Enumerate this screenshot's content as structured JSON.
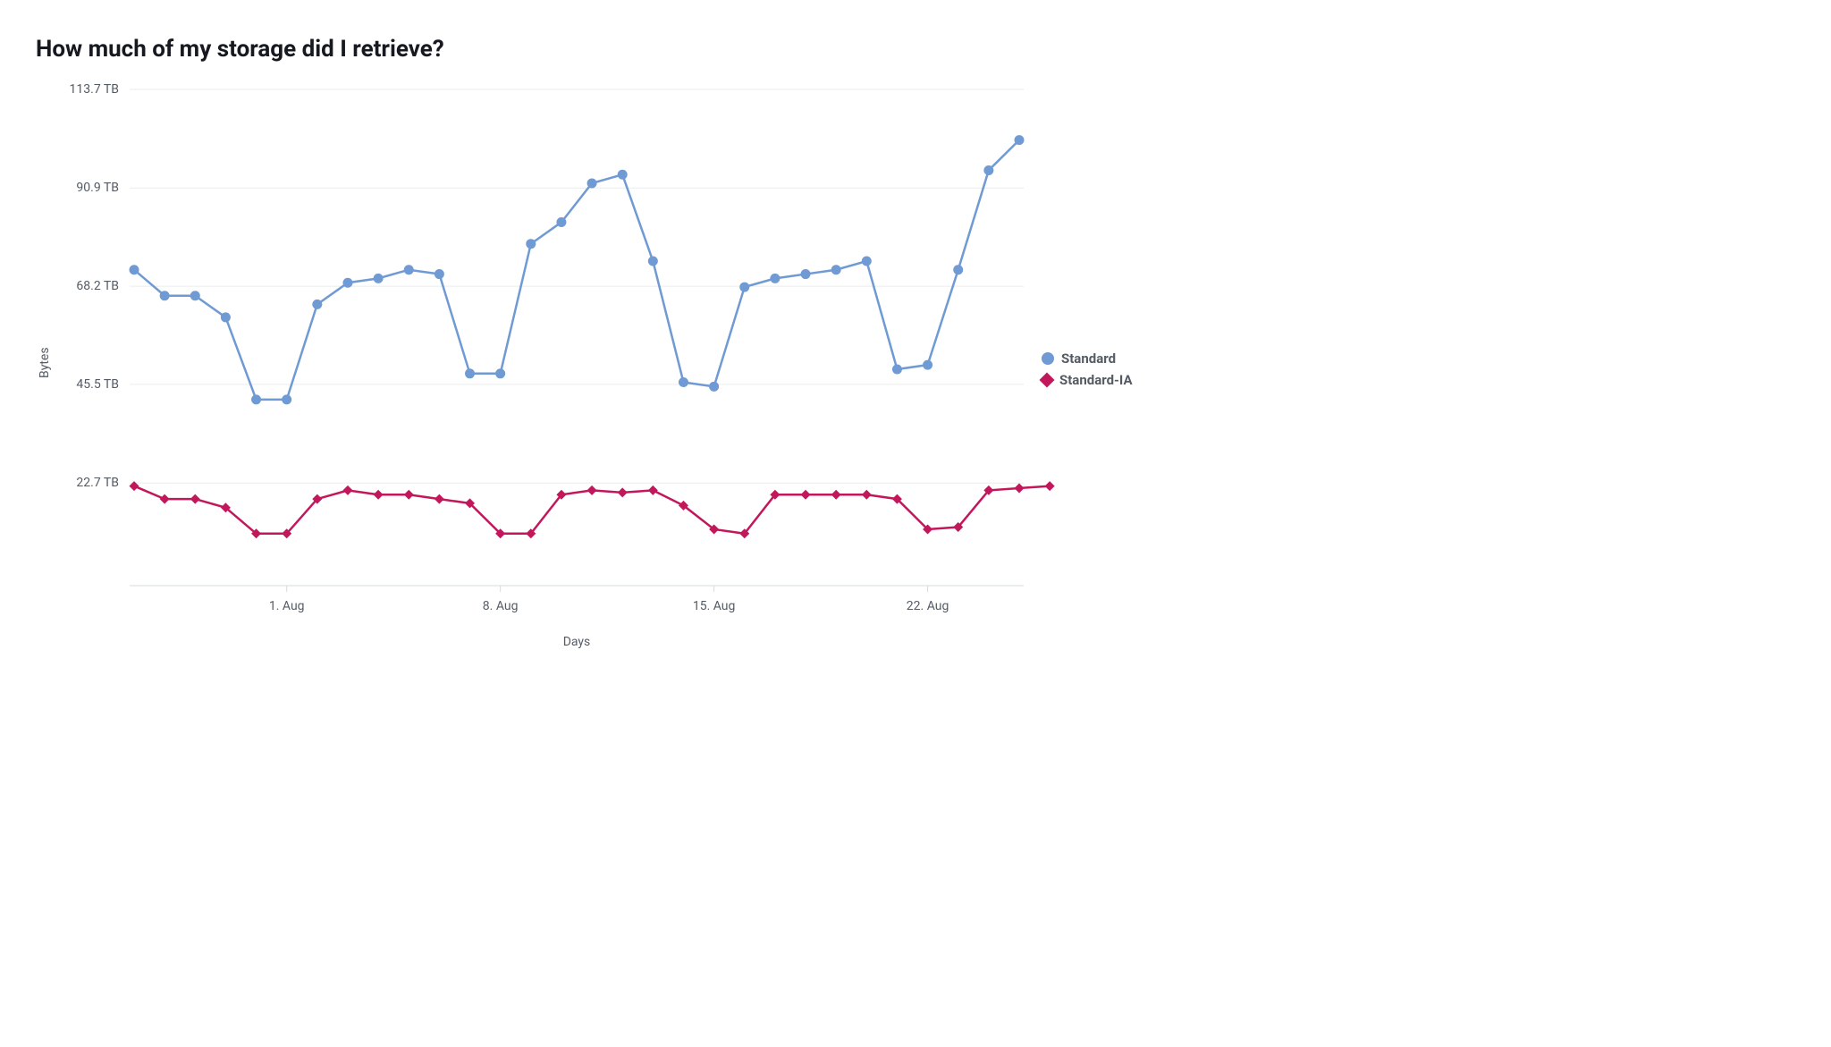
{
  "title": "How much of my storage did I retrieve?",
  "ylabel": "Bytes",
  "xlabel": "Days",
  "y_ticks": [
    "113.7 TB",
    "90.9 TB",
    "68.2 TB",
    "45.5 TB",
    "22.7 TB"
  ],
  "x_ticks": [
    "1. Aug",
    "8. Aug",
    "15. Aug",
    "22. Aug"
  ],
  "legend": {
    "standard": "Standard",
    "standard_ia": "Standard-IA"
  },
  "chart_data": {
    "type": "line",
    "xlabel": "Days",
    "ylabel": "Bytes",
    "title": "How much of my storage did I retrieve?",
    "ylim": [
      0,
      113.7
    ],
    "y_unit": "TB",
    "x": [
      "Jul 27",
      "Jul 28",
      "Jul 29",
      "Jul 30",
      "Jul 31",
      "Aug 1",
      "Aug 2",
      "Aug 3",
      "Aug 4",
      "Aug 5",
      "Aug 6",
      "Aug 7",
      "Aug 8",
      "Aug 9",
      "Aug 10",
      "Aug 11",
      "Aug 12",
      "Aug 13",
      "Aug 14",
      "Aug 15",
      "Aug 16",
      "Aug 17",
      "Aug 18",
      "Aug 19",
      "Aug 20",
      "Aug 21",
      "Aug 22",
      "Aug 23",
      "Aug 24"
    ],
    "x_tick_positions": [
      5,
      12,
      19,
      26
    ],
    "series": [
      {
        "name": "Standard",
        "marker": "circle",
        "color": "#6f9ad3",
        "values": [
          72,
          66,
          66,
          61,
          42,
          42,
          64,
          69,
          70,
          72,
          71,
          48,
          48,
          78,
          83,
          92,
          94,
          74,
          46,
          45,
          68,
          70,
          71,
          72,
          74,
          49,
          50,
          72,
          95,
          102
        ]
      },
      {
        "name": "Standard-IA",
        "marker": "diamond",
        "color": "#c2185b",
        "values": [
          22,
          19,
          19,
          17,
          11,
          11,
          19,
          21,
          20,
          20,
          19,
          18,
          11,
          11,
          20,
          21,
          20.5,
          21,
          17.5,
          12,
          11,
          20,
          20,
          20,
          20,
          19,
          12,
          12.5,
          21,
          21.5,
          22
        ]
      }
    ]
  }
}
